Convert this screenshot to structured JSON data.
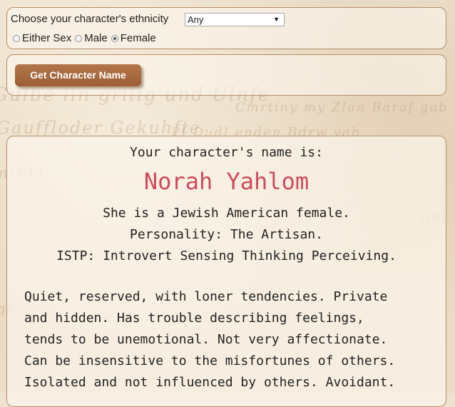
{
  "form": {
    "ethnicity_label": "Choose your character's ethnicity",
    "ethnicity_selected": "Any",
    "sex_options": [
      {
        "label": "Either Sex",
        "checked": false
      },
      {
        "label": "Male",
        "checked": false
      },
      {
        "label": "Female",
        "checked": true
      }
    ],
    "submit_label": "Get Character Name"
  },
  "result": {
    "intro": "Your character's name is:",
    "name": "Norah Yahlom",
    "line1": "She is a Jewish American female.",
    "line2": "Personality: The Artisan.",
    "line3": "ISTP: Introvert Sensing Thinking Perceiving.",
    "description_lines": [
      "Quiet, reserved, with loner tendencies. Private",
      "and hidden. Has trouble describing feelings,",
      "tends to be unemotional. Not very affectionate.",
      "Can be insensitive to the misfortunes of others.",
      "Isolated and not influenced by others. Avoidant."
    ]
  },
  "colors": {
    "name_accent": "#d04a5d",
    "button_brown": "#a8693f",
    "border": "#b58e66"
  }
}
